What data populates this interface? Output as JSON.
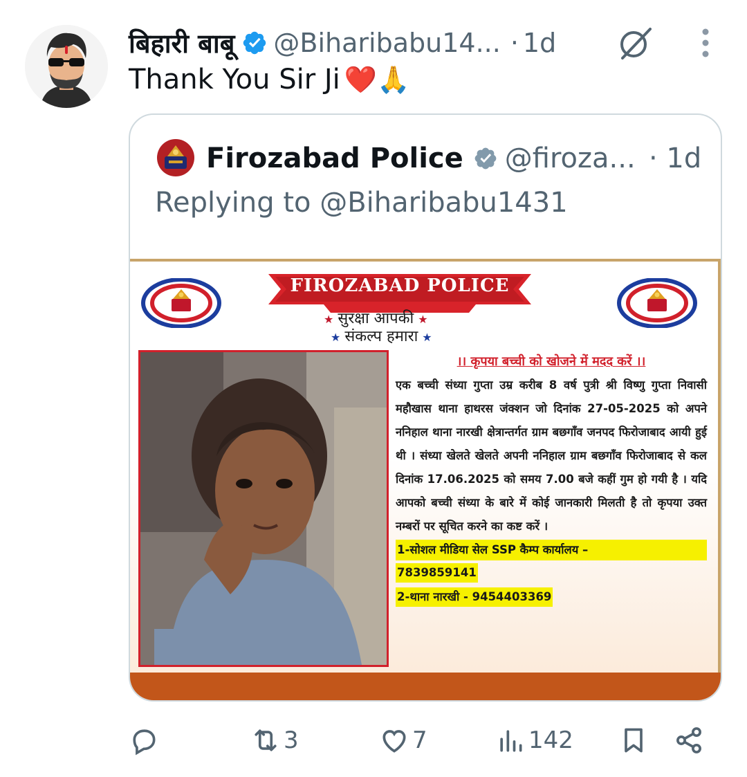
{
  "tweet": {
    "display_name": "बिहारी बाबू",
    "handle": "@Biharibabu14...",
    "separator": "·",
    "time": "1d",
    "text": "Thank You Sir Ji",
    "emojis": "❤️🙏"
  },
  "quoted": {
    "display_name": "Firozabad Police",
    "handle": "@firoza...",
    "time": "· 1d",
    "replying_to": "Replying to @Biharibabu1431",
    "poster": {
      "banner_title": "FIROZABAD POLICE",
      "slogan_line1": "सुरक्षा आपकी",
      "slogan_line2": "संकल्प हमारा",
      "notice_title": "।। कृपया बच्ची को खोजने में मदद करें ।।",
      "notice_body": "एक बच्ची संध्या गुप्ता उम्र करीब 8 वर्ष पुत्री श्री विष्णु गुप्ता निवासी महौखास थाना हाथरस जंक्शन जो दिनांक 27-05-2025 को अपने ननिहाल थाना नारखी क्षेत्रान्तर्गत ग्राम बछगाँव जनपद फिरोजाबाद आयी हुई थी । संध्या खेलते खेलते अपनी ननिहाल ग्राम बछगाँव फिरोजाबाद से कल दिनांक 17.06.2025 को समय 7.00 बजे कहीं गुम हो गयी है । यदि आपको बच्ची संध्या के बारे में कोई जानकारी मिलती है तो कृपया उक्त नम्बरों पर सूचित करने का कष्ट करें ।",
      "contact1_label": "1-सोशल मीडिया सेल SSP कैम्प कार्यालय –",
      "contact1_number": "7839859141",
      "contact2": "2-थाना नारखी - 9454403369"
    }
  },
  "actions": {
    "reply_count": "",
    "retweet_count": "3",
    "like_count": "7",
    "views_count": "142"
  },
  "colors": {
    "text_primary": "#0f1419",
    "text_secondary": "#536471",
    "verified_blue": "#1d9bf0",
    "verified_gray": "#829aab",
    "border": "#cfd9de"
  }
}
